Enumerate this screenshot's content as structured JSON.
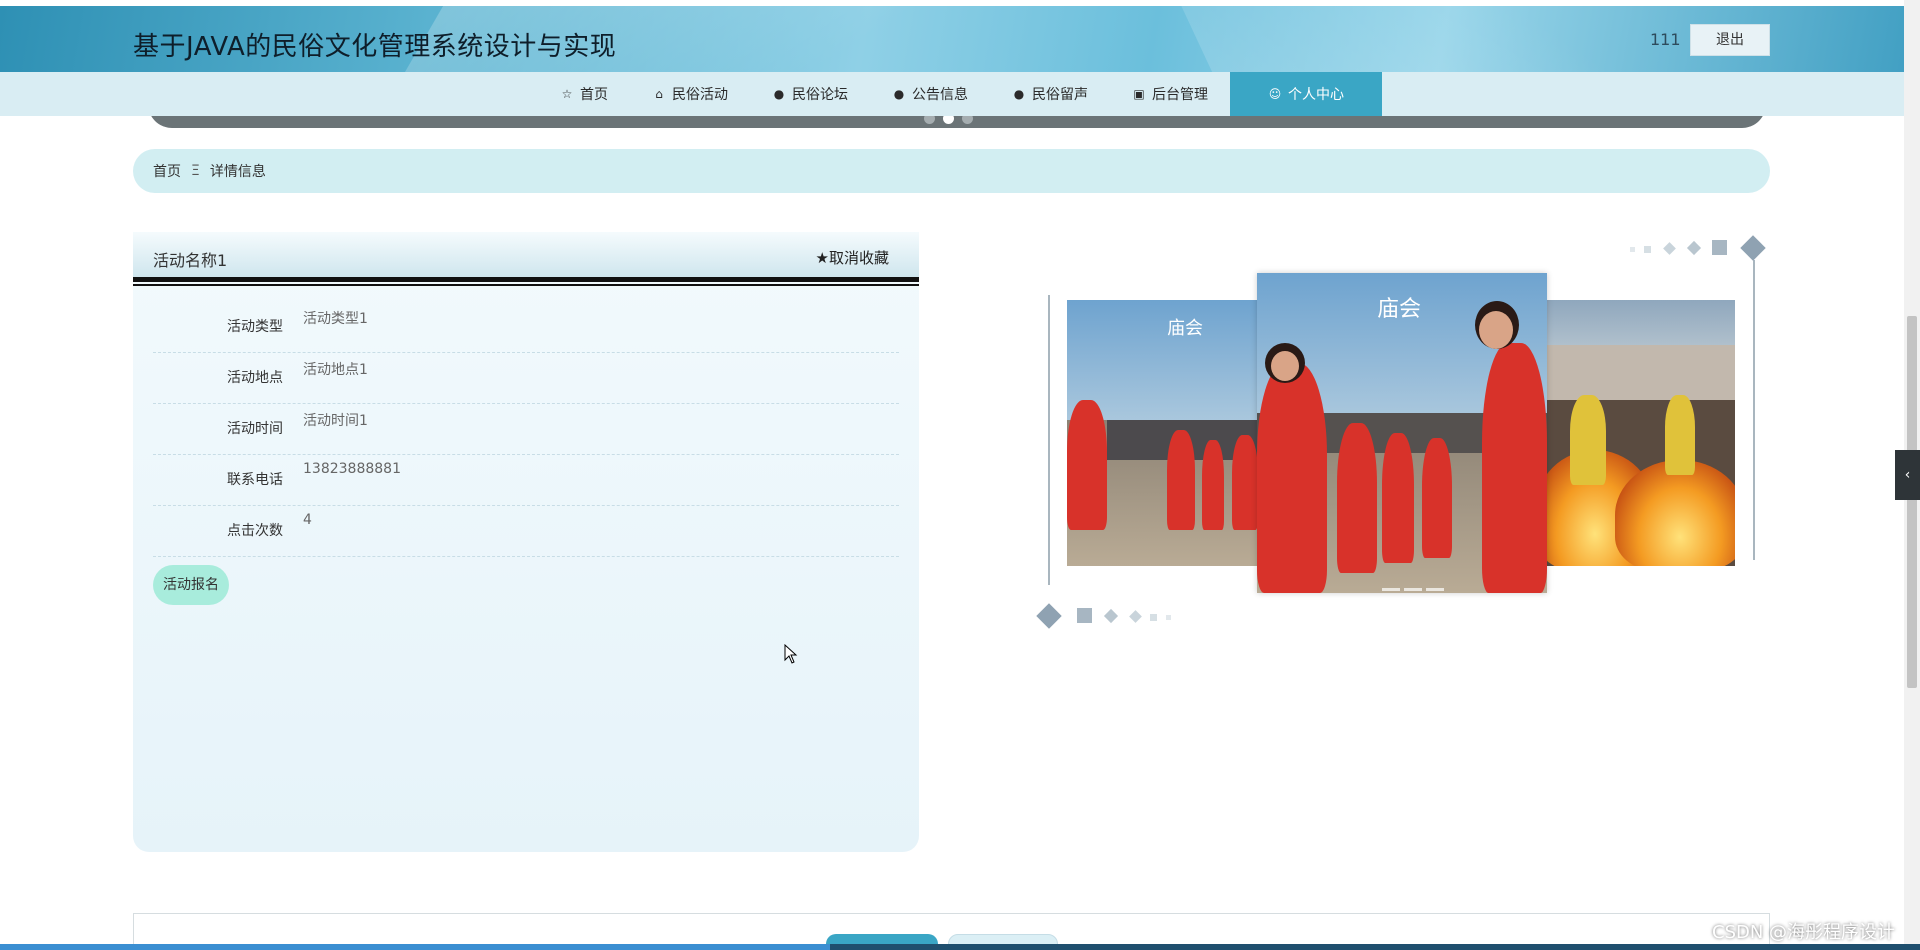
{
  "header": {
    "title": "基于JAVA的民俗文化管理系统设计与实现",
    "username": "111",
    "logout_label": "退出"
  },
  "nav": {
    "items": [
      {
        "label": "首页",
        "icon": "star-outline-icon"
      },
      {
        "label": "民俗活动",
        "icon": "bag-icon"
      },
      {
        "label": "民俗论坛",
        "icon": "alert-circle-icon"
      },
      {
        "label": "公告信息",
        "icon": "question-circle-icon"
      },
      {
        "label": "民俗留声",
        "icon": "info-circle-icon"
      },
      {
        "label": "后台管理",
        "icon": "briefcase-icon"
      },
      {
        "label": "个人中心",
        "icon": "user-icon"
      }
    ],
    "active_index": 6,
    "active_color": "#3aa6c5"
  },
  "breadcrumb": {
    "home": "首页",
    "separator": "Ξ",
    "current": "详情信息"
  },
  "detail": {
    "title": "活动名称1",
    "favorite_label": "取消收藏",
    "fields": [
      {
        "label": "活动类型",
        "value": "活动类型1"
      },
      {
        "label": "活动地点",
        "value": "活动地点1"
      },
      {
        "label": "活动时间",
        "value": "活动时间1"
      },
      {
        "label": "联系电话",
        "value": "13823888881"
      },
      {
        "label": "点击次数",
        "value": "4"
      }
    ],
    "signup_label": "活动报名"
  },
  "carousel": {
    "logo_text": "庙会"
  },
  "side_tab": {
    "icon": "chevron-left-icon",
    "glyph": "‹"
  },
  "watermark": "CSDN @海彤程序设计"
}
